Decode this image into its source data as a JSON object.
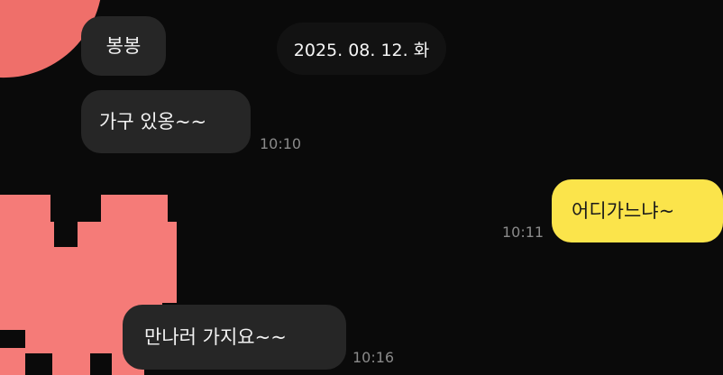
{
  "date_separator": "2025. 08. 12. 화",
  "messages": [
    {
      "text": "봉봉",
      "time": "",
      "side": "left"
    },
    {
      "text": "가구 있옹~~",
      "time": "10:10",
      "side": "left"
    },
    {
      "text": "어디가느냐~",
      "time": "10:11",
      "side": "right"
    },
    {
      "text": "만나러 가지요~~",
      "time": "10:16",
      "side": "left"
    }
  ],
  "colors": {
    "background": "#0a0a0a",
    "incoming_bubble": "#262626",
    "outgoing_bubble": "#fbe44b",
    "sticker_pink": "#f57b78"
  },
  "icons": {
    "top_left_sticker": "pink-blob-sticker-fragment",
    "pixel_heart": "pixel-heart-sticker"
  }
}
